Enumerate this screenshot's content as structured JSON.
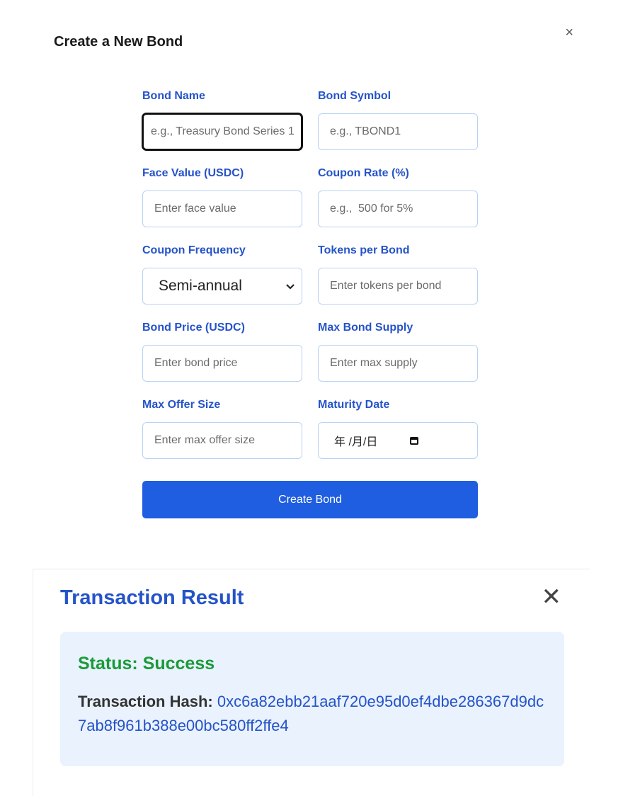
{
  "create_modal": {
    "title": "Create a New Bond",
    "close_symbol": "×",
    "fields": {
      "bond_name": {
        "label": "Bond Name",
        "placeholder": "e.g., Treasury Bond Series 1",
        "value": ""
      },
      "bond_symbol": {
        "label": "Bond Symbol",
        "placeholder": "e.g., TBOND1",
        "value": ""
      },
      "face_value": {
        "label": "Face Value (USDC)",
        "placeholder": "Enter face value",
        "value": ""
      },
      "coupon_rate": {
        "label": "Coupon Rate (%)",
        "placeholder": "e.g.,  500 for 5%",
        "value": ""
      },
      "coupon_frequency": {
        "label": "Coupon Frequency",
        "selected": "Semi-annual"
      },
      "tokens_per_bond": {
        "label": "Tokens per Bond",
        "placeholder": "Enter tokens per bond",
        "value": ""
      },
      "bond_price": {
        "label": "Bond Price (USDC)",
        "placeholder": "Enter bond price",
        "value": ""
      },
      "max_bond_supply": {
        "label": "Max Bond Supply",
        "placeholder": "Enter max supply",
        "value": ""
      },
      "max_offer_size": {
        "label": "Max Offer Size",
        "placeholder": "Enter max offer size",
        "value": ""
      },
      "maturity_date": {
        "label": "Maturity Date",
        "placeholder": "年 /月/日"
      }
    },
    "submit_label": "Create Bond"
  },
  "result_modal": {
    "title": "Transaction Result",
    "close_symbol": "✕",
    "status_text": "Status: Success",
    "hash_label": "Transaction Hash:",
    "hash_value": "0xc6a82ebb21aaf720e95d0ef4dbe286367d9dc7ab8f961b388e00bc580ff2ffe4"
  },
  "colors": {
    "accent": "#2553c8",
    "button": "#1f5ee0",
    "success": "#1a9a3a",
    "result_bg": "#e9f2fd"
  },
  "icons": {
    "close": "close-icon",
    "select_chevron": "chevron-down-icon",
    "calendar": "calendar-icon"
  }
}
